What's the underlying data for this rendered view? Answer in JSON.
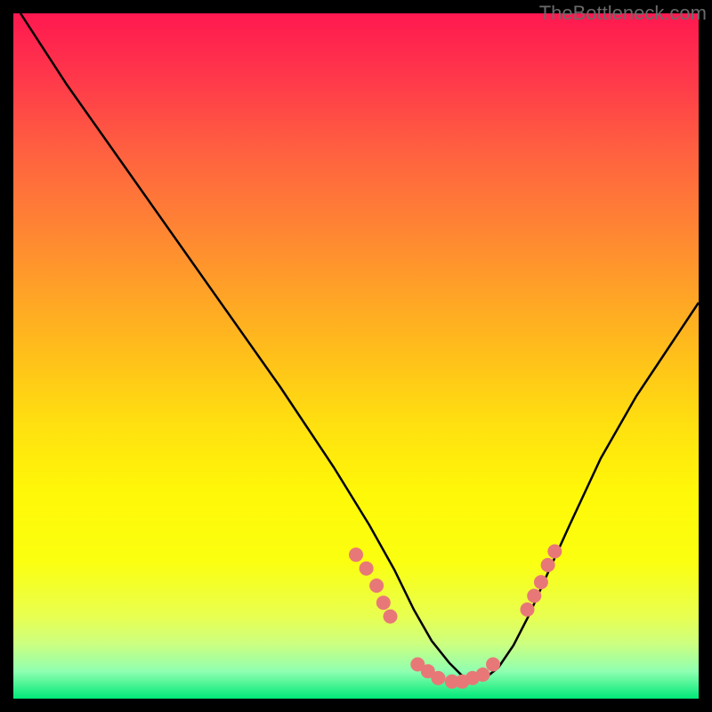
{
  "watermark": "TheBottleneck.com",
  "chart_data": {
    "type": "line",
    "title": "",
    "xlabel": "",
    "ylabel": "",
    "xlim": [
      0,
      100
    ],
    "ylim": [
      0,
      100
    ],
    "series": [
      {
        "name": "bottleneck-curve",
        "x": [
          1,
          5,
          10,
          15,
          20,
          25,
          30,
          35,
          40,
          45,
          50,
          53,
          56,
          59,
          62,
          65,
          68,
          71,
          74,
          77,
          80,
          85,
          90,
          95,
          100
        ],
        "y": [
          100,
          92,
          84,
          76,
          68,
          60,
          52,
          44,
          36,
          28,
          21,
          16,
          12,
          8,
          5,
          3,
          3,
          5,
          9,
          15,
          22,
          33,
          44,
          53,
          60
        ],
        "color": "#000000"
      }
    ],
    "markers": [
      {
        "x": 50,
        "y": 21
      },
      {
        "x": 51.5,
        "y": 19
      },
      {
        "x": 53,
        "y": 16.5
      },
      {
        "x": 54,
        "y": 14
      },
      {
        "x": 55,
        "y": 12
      },
      {
        "x": 59,
        "y": 5
      },
      {
        "x": 60.5,
        "y": 4
      },
      {
        "x": 62,
        "y": 3
      },
      {
        "x": 64,
        "y": 2.5
      },
      {
        "x": 65.5,
        "y": 2.5
      },
      {
        "x": 67,
        "y": 3
      },
      {
        "x": 68.5,
        "y": 3.5
      },
      {
        "x": 70,
        "y": 5
      },
      {
        "x": 75,
        "y": 13
      },
      {
        "x": 76,
        "y": 15
      },
      {
        "x": 77,
        "y": 17
      },
      {
        "x": 78,
        "y": 19.5
      },
      {
        "x": 79,
        "y": 21.5
      }
    ],
    "marker_color": "#e87878",
    "background_gradient": [
      "#ff1850",
      "#ffc01a",
      "#fff808",
      "#00e878"
    ]
  }
}
